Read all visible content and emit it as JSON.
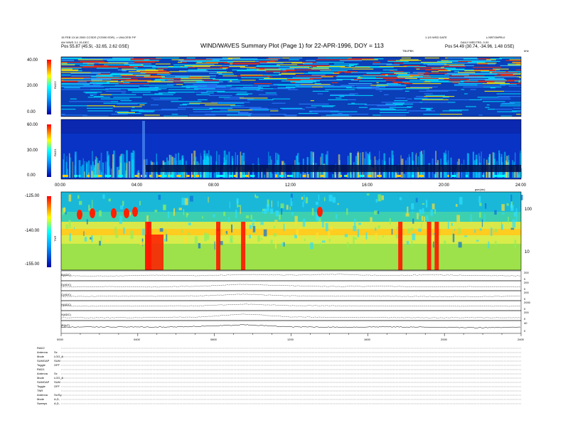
{
  "header": {
    "title": "WIND/WAVES Summary Plot (Page 1) for 22-APR-1996, DOY = 113",
    "left_line1": "15 FEB 13:16 2000 CCSDS (7/2000 EDR) -> UNLCESI F/F",
    "left_line2": "Ah/ WWS 3.1 15-DEC",
    "left_pos": "Pos    55.87 (45.5l, -32.65, 2.62 GSE)",
    "right_line1": "1.1/0 WSD DATE",
    "right_line1b": "L/XBTOMPB-0",
    "right_line2": "DAILY MEDTRD, 0.00",
    "right_pos": "Pos    54.49 (30.74, -34.96, 1.48 GSE)",
    "center_label": "TBUPBK",
    "khz_label": "kHz"
  },
  "panels": {
    "rad2": {
      "label": "RAD2",
      "ticks": [
        "40.00",
        "20.00",
        "0.00"
      ]
    },
    "rad1": {
      "label": "RAD1",
      "ticks": [
        "60.00",
        "30.00",
        "0.00"
      ]
    },
    "tnr": {
      "label": "TNR",
      "ticks": [
        "-125.00",
        "-140.00",
        "-155.00"
      ],
      "right_ticks": [
        "100",
        "10"
      ]
    }
  },
  "time_axis": {
    "labels": [
      "00:00",
      "04:00",
      "08:00",
      "12:00",
      "16:00",
      "20:00",
      "24:00"
    ],
    "right_tag": "gse(utc)"
  },
  "lines": {
    "labels": [
      "B(ADC)",
      "D(ADC)",
      "C(ADC)",
      "H(ADC)",
      "X(ADC)",
      "|B|(nT)"
    ],
    "right_ticks": [
      [
        "200",
        "0"
      ],
      [
        "200",
        "0"
      ],
      [
        "200",
        "0"
      ],
      [
        "2000",
        "0"
      ],
      [
        "200",
        "0"
      ],
      [
        "40",
        "0"
      ]
    ]
  },
  "bottom_axis": {
    "labels": [
      "0000",
      "0400",
      "0800",
      "1200",
      "1600",
      "2000",
      "2400"
    ]
  },
  "footer": {
    "rows": [
      {
        "k": "RAD2",
        "v": ""
      },
      {
        "k": "Antenna",
        "v": "Sx"
      },
      {
        "k": "Mode",
        "v": "LOG_6"
      },
      {
        "k": "SUMGAP",
        "v": "SUM"
      },
      {
        "k": "Toggle",
        "v": "OFF"
      },
      {
        "k": "RAD1",
        "v": ""
      },
      {
        "k": "Antenna",
        "v": "Sx"
      },
      {
        "k": "Mode",
        "v": "LOG_6"
      },
      {
        "k": "SUMGAP",
        "v": "SUM"
      },
      {
        "k": "Toggle",
        "v": "OFF"
      },
      {
        "k": "TNR",
        "v": ""
      },
      {
        "k": "Antenna",
        "v": "Sx/Sy"
      },
      {
        "k": "Mode",
        "v": "A,D,"
      },
      {
        "k": "Sweeps",
        "v": "A,D,"
      }
    ]
  },
  "colors": {
    "spec_low": "#0a2ea8",
    "spec_mid": "#00c8ff",
    "spec_high": "#ffff00",
    "spec_peak": "#ff0000",
    "tnr_bg": "#9de24a"
  },
  "chart_data": [
    {
      "type": "heatmap",
      "title": "WIND/WAVES Summary Plot (Page 1) for 22-APR-1996, DOY = 113",
      "ylabel": "RAD2",
      "ylim": [
        0,
        40
      ],
      "xlim_hours": [
        0,
        24
      ],
      "colorbar": [
        "#0000a0",
        "#00ffff",
        "#ffff00",
        "#ff0000"
      ]
    },
    {
      "type": "heatmap",
      "ylabel": "RAD1",
      "ylim": [
        0,
        60
      ],
      "xlim_hours": [
        0,
        24
      ]
    },
    {
      "type": "heatmap",
      "ylabel": "TNR",
      "ylim": [
        -155,
        -125
      ],
      "xlim_hours": [
        0,
        24
      ],
      "bursts_hours": [
        4.5,
        4.6,
        8.2,
        9.5,
        17.7,
        19.2,
        19.6
      ]
    },
    {
      "type": "line",
      "series": [
        {
          "name": "B(ADC)",
          "values": [
            120,
            110,
            140,
            125,
            160,
            140,
            170,
            130,
            150,
            130,
            120
          ]
        },
        {
          "name": "D(ADC)",
          "values": [
            60,
            70,
            60,
            80,
            130,
            90,
            70,
            80,
            60,
            70,
            60
          ]
        },
        {
          "name": "C(ADC)",
          "values": [
            80,
            90,
            90,
            100,
            150,
            100,
            90,
            90,
            80,
            80,
            90
          ]
        },
        {
          "name": "H(ADC)",
          "values": [
            300,
            300,
            320,
            340,
            500,
            360,
            330,
            320,
            310,
            300,
            300
          ]
        },
        {
          "name": "X(ADC)",
          "values": [
            40,
            40,
            45,
            60,
            140,
            60,
            50,
            45,
            40,
            40,
            40
          ]
        },
        {
          "name": "|B|(nT)",
          "values": [
            12,
            13,
            12,
            14,
            18,
            13,
            12,
            13,
            12,
            11,
            12
          ]
        }
      ],
      "x_hours": [
        0,
        2.4,
        4.8,
        7.2,
        9.6,
        12,
        14.4,
        16.8,
        19.2,
        21.6,
        24
      ]
    }
  ]
}
